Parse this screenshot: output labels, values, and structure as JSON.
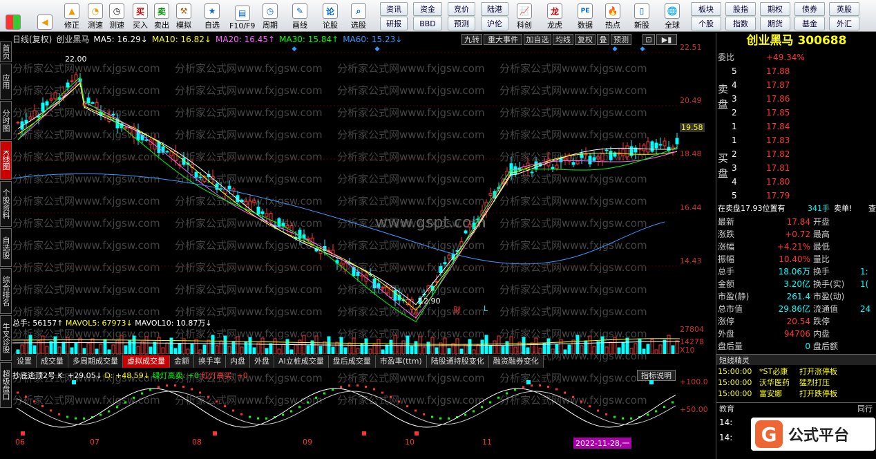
{
  "toolbar": {
    "buttons": [
      {
        "label": "",
        "icon": "windows-logo-icon"
      },
      {
        "label": "",
        "icon": "back-arrow-icon"
      },
      {
        "label": "修正",
        "icon": "up-arrow-icon"
      },
      {
        "label": "测速",
        "icon": "speed-icon"
      },
      {
        "label": "买入",
        "icon": "buy-icon"
      },
      {
        "label": "卖出",
        "icon": "sell-icon"
      },
      {
        "label": "模拟",
        "icon": "hammer-icon"
      },
      {
        "label": "自选",
        "icon": "star-icon"
      },
      {
        "label": "F10/F9",
        "icon": "f10-icon"
      },
      {
        "label": "周期",
        "icon": "period-icon"
      },
      {
        "label": "画线",
        "icon": "pencil-icon"
      },
      {
        "label": "论股",
        "icon": "discuss-icon"
      },
      {
        "label": "选股",
        "icon": "select-icon"
      }
    ],
    "small_buttons": [
      "资讯",
      "资金",
      "竞价",
      "陆港",
      "研报",
      "BBD",
      "预测",
      "沪伦"
    ],
    "icon_buttons": [
      "科创",
      "龙虎",
      "数据",
      "热点",
      "新股"
    ],
    "global": "全球",
    "right_buttons": [
      "板块",
      "股指",
      "期权",
      "债券",
      "英股",
      "个股",
      "指数",
      "期货",
      "基金",
      "外汇"
    ]
  },
  "sidebar": [
    "首页",
    "应用",
    "分时图",
    "K线图",
    "个股资料",
    "自选股",
    "综合排名",
    "牛叉诊股",
    "超级盘口"
  ],
  "info": {
    "period": "日线(复权)",
    "name": "创业黑马",
    "ma5": "MA5: 16.29↓",
    "ma10": "MA10: 16.82↓",
    "ma20": "MA20: 16.45↑",
    "ma30": "MA30: 15.84↑",
    "ma60": "MA60: 15.23↓"
  },
  "kline_buttons": [
    "九转",
    "重大事件",
    "加自选",
    "均线",
    "复权",
    "叠",
    "预测"
  ],
  "price_axis": [
    "22.51",
    "20.49",
    "18.48",
    "16.44",
    "14.43"
  ],
  "crosshair_price": "19.58",
  "high_label": "22.00",
  "low_label": "12.90",
  "marker_cai": "财",
  "marker_l": "L",
  "volume": {
    "total": "总手: 56157↑",
    "mavol5": "MAVOL5: 67973↓",
    "mavol10": "MAVOL10: 10.87万↓",
    "axis_top": "27804",
    "axis_mid": "14278",
    "axis_unit": "X10"
  },
  "tabs": [
    "设置",
    "成交量",
    "多周期成交量",
    "虚拟成交量",
    "金额",
    "换手率",
    "内盘",
    "外盘",
    "AI立桩成交量",
    "盘后成交量",
    "市盈率(ttm)",
    "陆股通持股变化",
    "融资融券变化"
  ],
  "indicator": {
    "name": "抄底逃顶2号",
    "k": "K: +29.05↓",
    "d": "D: +48.59↓",
    "green_buy": "绿灯高卖: +0",
    "red_sell": "红灯高买: +0",
    "explain_btn": "指标说明",
    "axis_100": "+100.0",
    "axis_50": "+50.00"
  },
  "dates": [
    "06",
    "07",
    "08",
    "09",
    "10",
    "11"
  ],
  "date_cursor": "2022-11-28,一",
  "watermark": "分析家公式网www.fxjgsw.com",
  "watermark2": "www.gspt.com",
  "quote": {
    "title": "创业黑马 300688",
    "weibi_label": "委比",
    "weibi": "+49.34%",
    "sell_label": "卖盘",
    "buy_label": "买盘",
    "sells": [
      {
        "n": "5",
        "p": "17.88"
      },
      {
        "n": "4",
        "p": "17.87"
      },
      {
        "n": "3",
        "p": "17.86"
      },
      {
        "n": "2",
        "p": "17.85"
      },
      {
        "n": "1",
        "p": "17.84"
      }
    ],
    "buys": [
      {
        "n": "1",
        "p": "17.83"
      },
      {
        "n": "2",
        "p": "17.82"
      },
      {
        "n": "3",
        "p": "17.81"
      },
      {
        "n": "4",
        "p": "17.80"
      },
      {
        "n": "5",
        "p": "17.79"
      }
    ],
    "order_line": "在卖盘17.93位置有",
    "order_qty": "341手",
    "order_tag": "卖单!",
    "order_more": "查",
    "stats": [
      {
        "l": "最新",
        "v": "17.84",
        "l2": "开盘"
      },
      {
        "l": "涨跌",
        "v": "+0.72",
        "l2": "最高"
      },
      {
        "l": "涨幅",
        "v": "+4.21%",
        "l2": "最低"
      },
      {
        "l": "振幅",
        "v": "10.40%",
        "l2": "量比"
      },
      {
        "l": "总手",
        "v": "18.06万",
        "l2": "换手"
      },
      {
        "l": "金额",
        "v": "3.20亿",
        "l2": "换手(实)"
      },
      {
        "l": "市盈(静)",
        "v": "261.4",
        "l2": "市盈(动)"
      },
      {
        "l": "总市值",
        "v": "29.86亿",
        "l2": "流通值"
      },
      {
        "l": "涨停",
        "v": "20.54",
        "l2": "跌停"
      },
      {
        "l": "外盘",
        "v": "94706",
        "l2": "内盘"
      },
      {
        "l": "盘后量",
        "v": "0",
        "l2": "盘后额"
      }
    ],
    "stats_right": [
      "",
      "",
      "",
      "",
      "1:",
      "1(",
      "",
      "24",
      "",
      "",
      ""
    ],
    "sprite_title": "短线精灵",
    "sprites": [
      {
        "t": "15:00:00",
        "s": "*ST必康",
        "e": "打开涨停板"
      },
      {
        "t": "15:00:00",
        "s": "沃华医药",
        "e": "猛烈打压"
      },
      {
        "t": "15:00:00",
        "s": "富安娜",
        "e": "打开跌停板"
      }
    ],
    "edu": "教育",
    "peer": "同行"
  },
  "logo_text": "公式平台",
  "colors": {
    "up": "#ff3333",
    "down": "#00ffff",
    "ma5": "#ffffff",
    "ma10": "#ffff00",
    "ma20": "#ff66ff",
    "ma30": "#00ff00",
    "ma60": "#3399ff"
  }
}
